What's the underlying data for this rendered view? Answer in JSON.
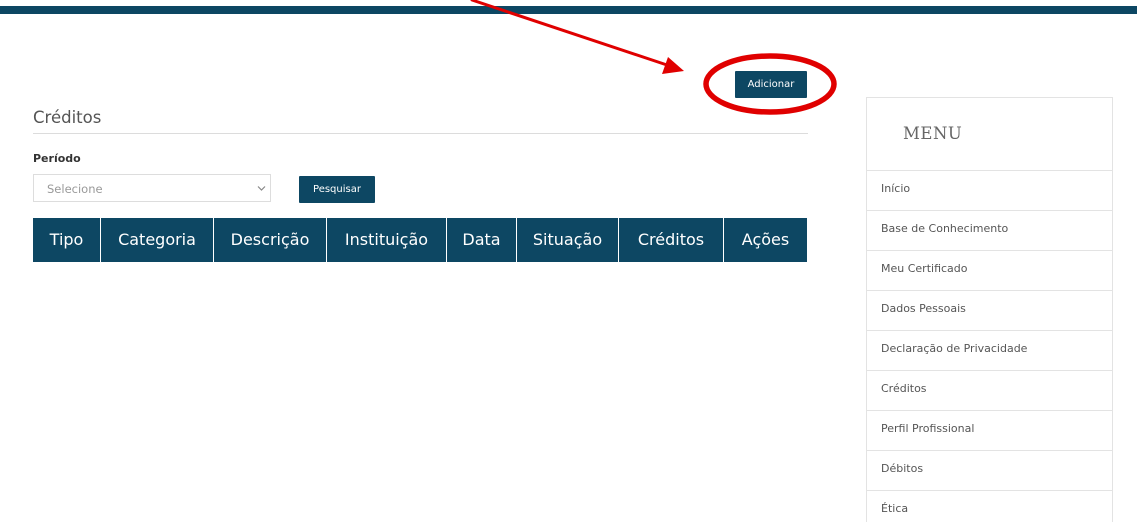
{
  "header": {
    "stripe_color": "#0d4763"
  },
  "actions": {
    "add_label": "Adicionar"
  },
  "page": {
    "title": "Créditos",
    "period_label": "Período",
    "period_select": {
      "selected": "Selecione",
      "options": [
        "Selecione"
      ]
    },
    "search_label": "Pesquisar"
  },
  "table": {
    "columns": [
      "Tipo",
      "Categoria",
      "Descrição",
      "Instituição",
      "Data",
      "Situação",
      "Créditos",
      "Ações"
    ],
    "rows": []
  },
  "menu": {
    "title": "MENU",
    "items": [
      {
        "label": "Início"
      },
      {
        "label": "Base de Conhecimento"
      },
      {
        "label": "Meu Certificado"
      },
      {
        "label": "Dados Pessoais"
      },
      {
        "label": "Declaração de Privacidade"
      },
      {
        "label": "Créditos"
      },
      {
        "label": "Perfil Profissional"
      },
      {
        "label": "Débitos"
      },
      {
        "label": "Ética"
      }
    ]
  },
  "annotation": {
    "color": "#e00000"
  },
  "theme": {
    "primary": "#0d4763",
    "border": "#e3e3e3"
  }
}
